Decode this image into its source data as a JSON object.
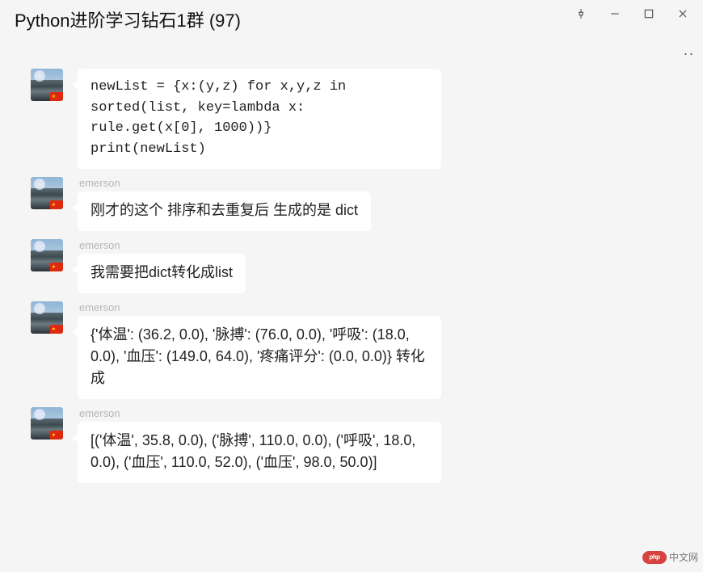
{
  "header": {
    "title": "Python进阶学习钻石1群 (97)"
  },
  "messages": [
    {
      "username": "",
      "text": "newList = {x:(y,z) for x,y,z in sorted(list, key=lambda x: rule.get(x[0], 1000))}\nprint(newList)",
      "is_code": true
    },
    {
      "username": "emerson",
      "text": "刚才的这个 排序和去重复后 生成的是 dict",
      "is_code": false
    },
    {
      "username": "emerson",
      "text": "我需要把dict转化成list",
      "is_code": false
    },
    {
      "username": "emerson",
      "text": "{'体温': (36.2, 0.0), '脉搏': (76.0, 0.0), '呼吸': (18.0, 0.0), '血压': (149.0, 64.0), '疼痛评分': (0.0, 0.0)}  转化成",
      "is_code": false
    },
    {
      "username": "emerson",
      "text": "  [('体温', 35.8, 0.0), ('脉搏', 110.0, 0.0), ('呼吸', 18.0, 0.0), ('血压', 110.0, 52.0), ('血压', 98.0, 50.0)]",
      "is_code": false
    }
  ],
  "watermark": {
    "pill": "php",
    "text": "中文网"
  },
  "icons": {
    "pin": "pin-icon",
    "minimize": "minimize-icon",
    "maximize": "maximize-icon",
    "close": "close-icon",
    "more": ".."
  }
}
